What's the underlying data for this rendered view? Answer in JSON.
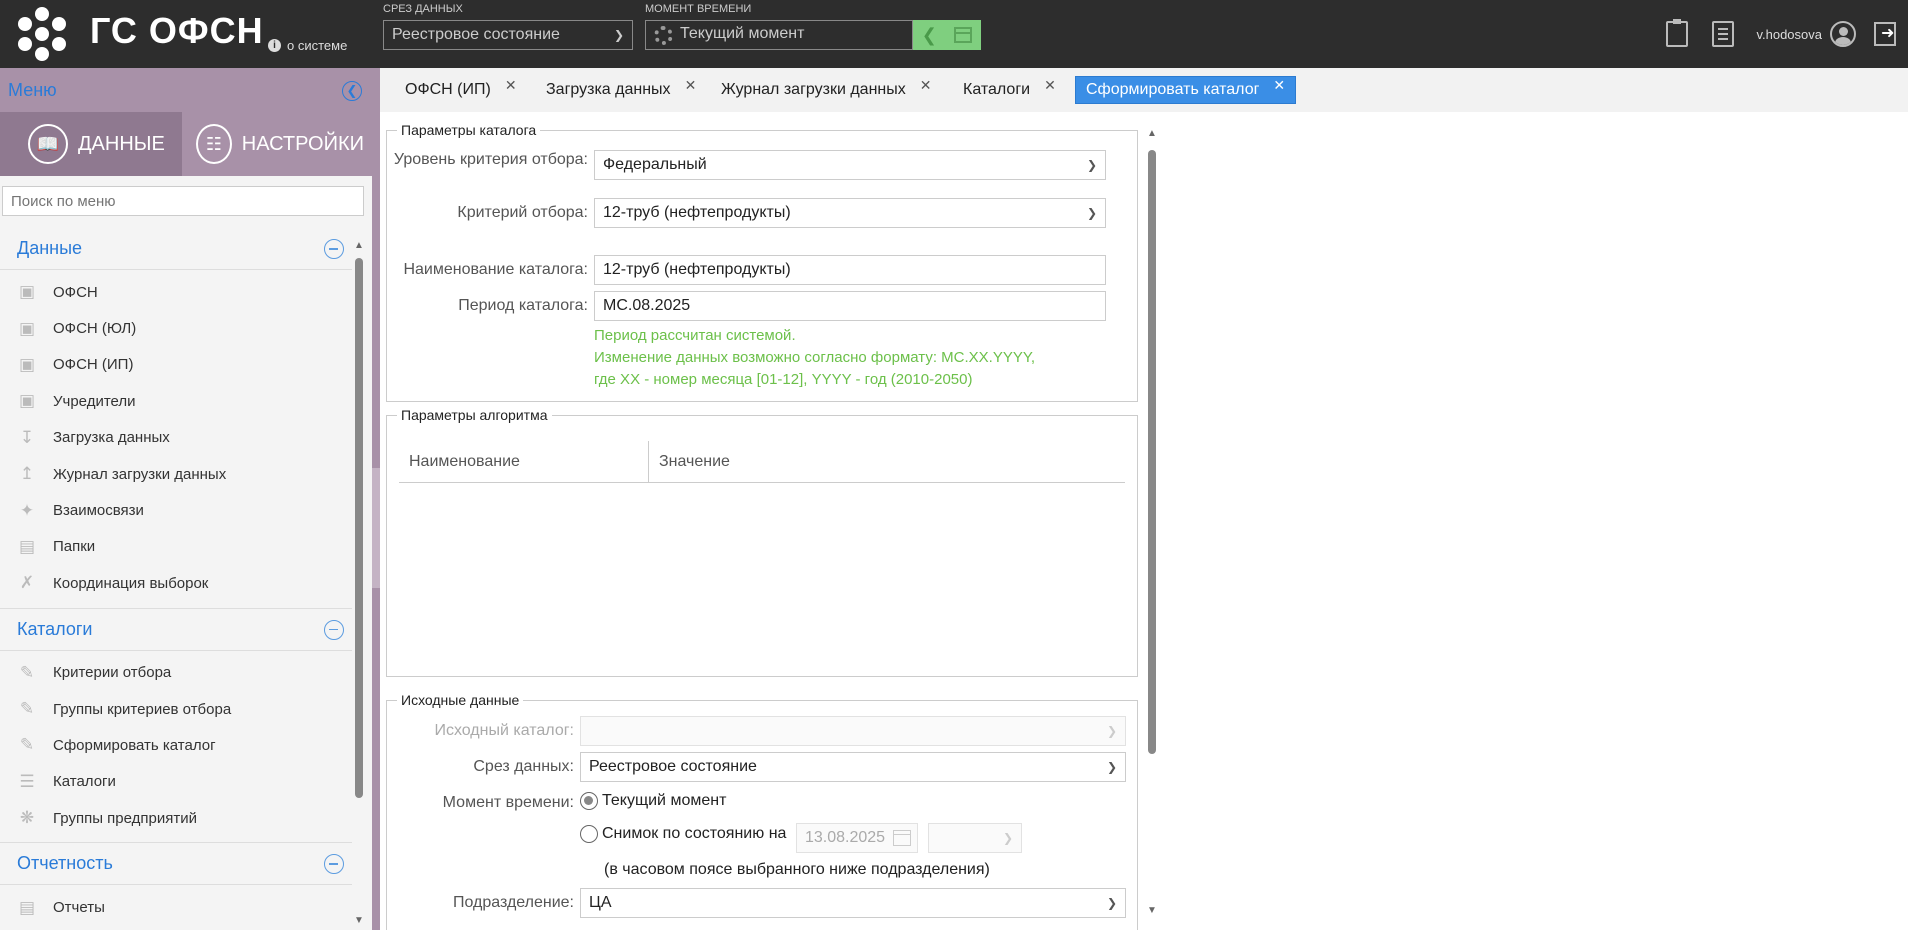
{
  "header": {
    "app_title": "ГС ОФСН",
    "about_label": "о системе",
    "data_slice_label": "СРЕЗ ДАННЫХ",
    "data_slice_value": "Реестровое состояние",
    "moment_label": "МОМЕНТ ВРЕМЕНИ",
    "moment_value": "Текущий момент",
    "username": "v.hodosova",
    "colors": {
      "bar": "#2d2d2d",
      "moment_button": "#7fcf7f"
    }
  },
  "sidebar": {
    "menu_title": "Меню",
    "tabs": [
      {
        "label": "ДАННЫЕ",
        "icon": "book-icon"
      },
      {
        "label": "НАСТРОЙКИ",
        "icon": "sliders-icon"
      }
    ],
    "search_placeholder": "Поиск по меню",
    "sections": [
      {
        "title": "Данные",
        "items": [
          {
            "label": "ОФСН",
            "icon": "database-icon"
          },
          {
            "label": "ОФСН (ЮЛ)",
            "icon": "database-icon"
          },
          {
            "label": "ОФСН (ИП)",
            "icon": "database-icon"
          },
          {
            "label": "Учредители",
            "icon": "database-icon"
          },
          {
            "label": "Загрузка данных",
            "icon": "download-icon"
          },
          {
            "label": "Журнал загрузки данных",
            "icon": "upload-log-icon"
          },
          {
            "label": "Взаимосвязи",
            "icon": "network-icon"
          },
          {
            "label": "Папки",
            "icon": "folder-icon"
          },
          {
            "label": "Координация выборок",
            "icon": "coordination-icon"
          }
        ]
      },
      {
        "title": "Каталоги",
        "items": [
          {
            "label": "Критерии отбора",
            "icon": "criteria-icon"
          },
          {
            "label": "Группы критериев отбора",
            "icon": "criteria-group-icon"
          },
          {
            "label": "Сформировать каталог",
            "icon": "build-catalog-icon"
          },
          {
            "label": "Каталоги",
            "icon": "catalog-icon"
          },
          {
            "label": "Группы предприятий",
            "icon": "enterprise-group-icon"
          }
        ]
      },
      {
        "title": "Отчетность",
        "items": [
          {
            "label": "Отчеты",
            "icon": "report-icon"
          }
        ]
      }
    ]
  },
  "tabs": [
    {
      "label": "ОФСН (ИП)"
    },
    {
      "label": "Загрузка данных"
    },
    {
      "label": "Журнал загрузки данных"
    },
    {
      "label": "Каталоги"
    },
    {
      "label": "Сформировать каталог"
    }
  ],
  "active_tab_color": "#3a8ee6",
  "form": {
    "catalog_params": {
      "legend": "Параметры каталога",
      "level_label": "Уровень критерия отбора:",
      "level_value": "Федеральный",
      "criterion_label": "Критерий отбора:",
      "criterion_value": "12-труб (нефтепродукты)",
      "name_label": "Наименование каталога:",
      "name_value": "12-труб (нефтепродукты)",
      "period_label": "Период каталога:",
      "period_value": "MC.08.2025",
      "hint_lines": [
        "Период рассчитан системой.",
        "Изменение данных возможно согласно формату: MC.XX.YYYY,",
        "где XX - номер месяца [01-12], YYYY - год (2010-2050)"
      ],
      "hint_color": "#6cc04a"
    },
    "algorithm_params": {
      "legend": "Параметры алгоритма",
      "columns": [
        "Наименование",
        "Значение"
      ],
      "rows": []
    },
    "source_data": {
      "legend": "Исходные данные",
      "source_catalog_label": "Исходный каталог:",
      "source_catalog_value": "",
      "slice_label": "Срез данных:",
      "slice_value": "Реестровое состояние",
      "moment_label": "Момент времени:",
      "option_current": "Текущий момент",
      "option_snapshot": "Снимок по состоянию на",
      "snapshot_date": "13.08.2025",
      "snapshot_time": "",
      "timezone_note": "(в часовом поясе выбранного ниже подразделения)",
      "selected_option": "current",
      "unit_label": "Подразделение:",
      "unit_value": "ЦА"
    }
  }
}
